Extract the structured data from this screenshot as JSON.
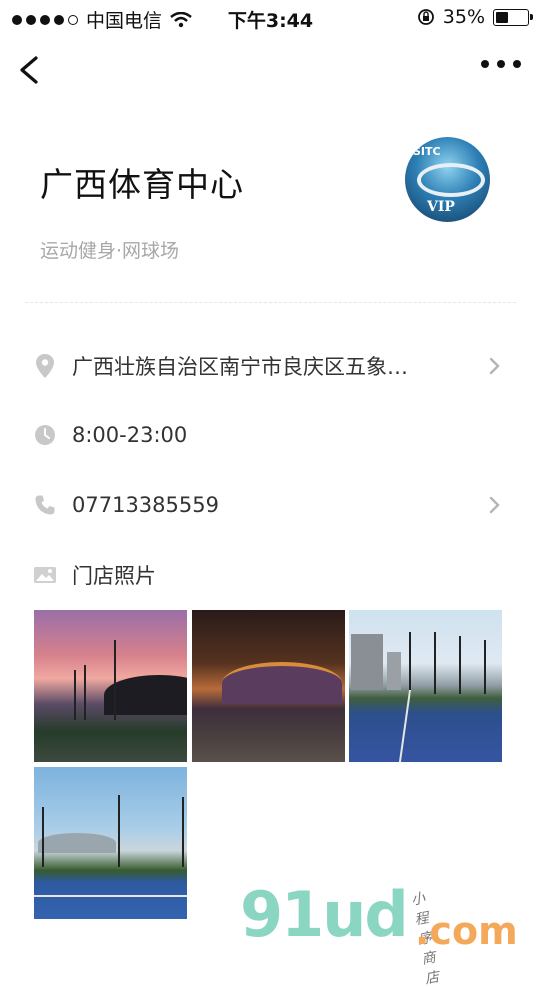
{
  "status_bar": {
    "carrier": "中国电信",
    "time": "下午3:44",
    "battery": "35%"
  },
  "venue": {
    "name": "广西体育中心",
    "category": "运动健身·网球场",
    "logo_text": "SITC",
    "logo_badge": "VIP"
  },
  "info": {
    "address": "广西壮族自治区南宁市良庆区五象…",
    "hours": "8:00-23:00",
    "phone": "07713385559",
    "photos_label": "门店照片"
  },
  "photos": [
    "stadium-sunset",
    "stadium-night",
    "tennis-court-day",
    "tennis-court-sky"
  ],
  "watermark": {
    "brand": "91ud",
    "domain": ".com",
    "slogan": "小程序商店"
  },
  "colors": {
    "icon_gray": "#c8c8c8",
    "subtext": "#a8a8a8",
    "wm_green": "#8bd6c2",
    "wm_orange": "#f3a85a"
  }
}
